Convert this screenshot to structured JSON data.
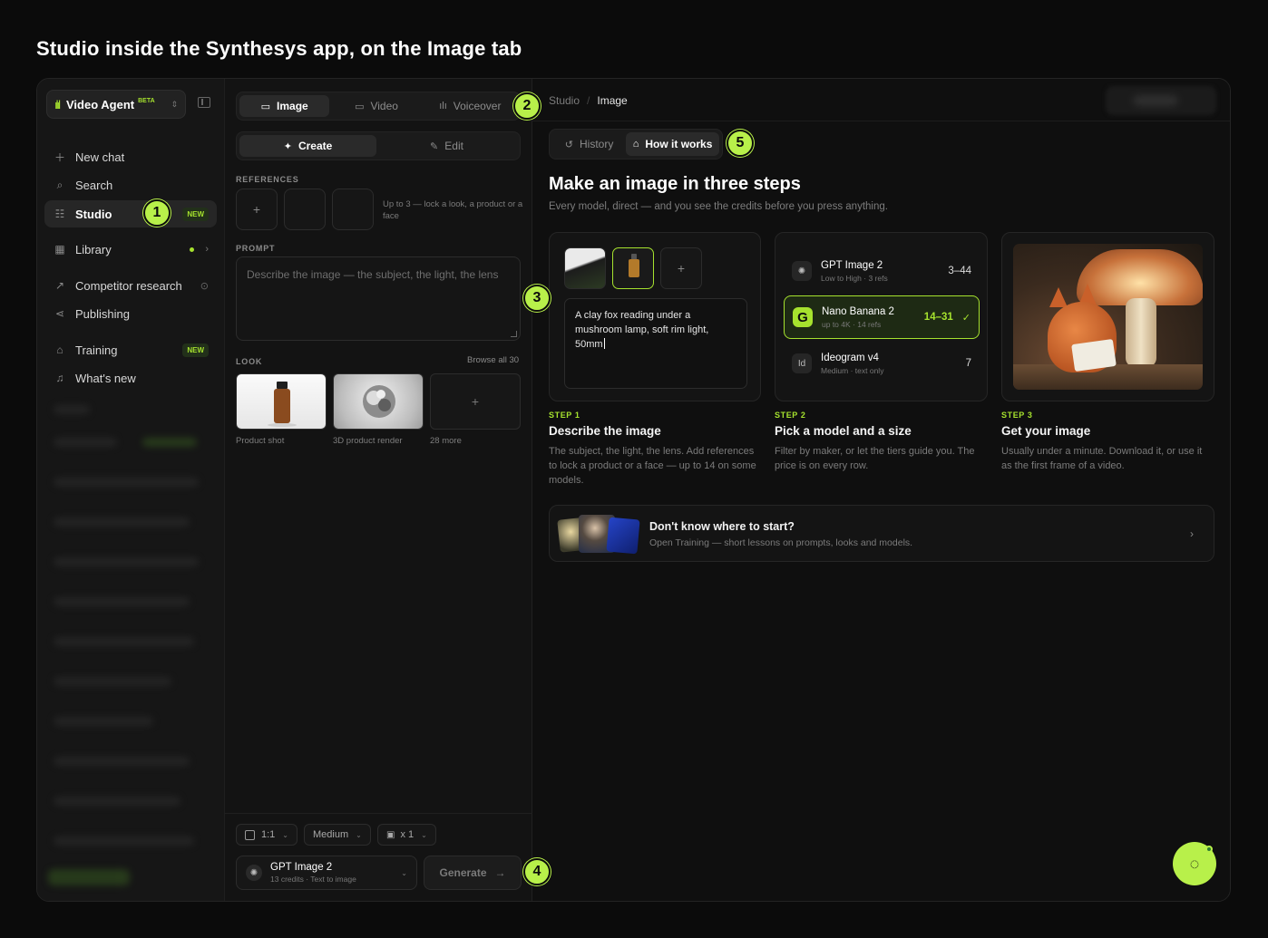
{
  "page_title": "Studio inside the Synthesys app, on the Image tab",
  "sidebar": {
    "agent_name": "Video Agent",
    "agent_badge": "BETA",
    "items": [
      {
        "label": "New chat",
        "icon": "plus-icon"
      },
      {
        "label": "Search",
        "icon": "search-icon"
      },
      {
        "label": "Studio",
        "icon": "sliders-icon",
        "badge": "NEW",
        "active": true
      },
      {
        "label": "Library",
        "icon": "grid-icon"
      },
      {
        "label": "Competitor research",
        "icon": "trend-icon"
      },
      {
        "label": "Publishing",
        "icon": "share-icon"
      },
      {
        "label": "Training",
        "icon": "graduation-cap-icon",
        "badge": "NEW"
      },
      {
        "label": "What's new",
        "icon": "bell-icon"
      }
    ]
  },
  "composer": {
    "mode_tabs": [
      "Image",
      "Video",
      "Voiceover"
    ],
    "action_tabs": [
      "Create",
      "Edit"
    ],
    "references_label": "REFERENCES",
    "references_hint": "Up to 3 — lock a look, a product or a face",
    "prompt_label": "PROMPT",
    "prompt_placeholder": "Describe the image — the subject, the light, the lens",
    "look_label": "LOOK",
    "browse_all": "Browse all 30",
    "looks": [
      "Product shot",
      "3D product render",
      "28 more"
    ],
    "aspect": "1:1",
    "quality": "Medium",
    "count": "x 1",
    "model_name": "GPT Image 2",
    "model_sub": "13 credits · Text to image",
    "generate_label": "Generate"
  },
  "main": {
    "breadcrumb": [
      "Studio",
      "Image"
    ],
    "tabs": [
      "History",
      "How it works"
    ],
    "heading": "Make an image in three steps",
    "subheading": "Every model, direct — and you see the credits before you press anything.",
    "step1": {
      "prompt_text": "A clay fox reading under a mushroom lamp, soft rim light, 50mm",
      "no": "STEP 1",
      "title": "Describe the image",
      "desc": "The subject, the light, the lens. Add references to lock a product or a face — up to 14 on some models."
    },
    "step2": {
      "models": [
        {
          "name": "GPT Image 2",
          "sub": "Low to High · 3 refs",
          "price": "3–44",
          "icon": "G"
        },
        {
          "name": "Nano Banana 2",
          "sub": "up to 4K · 14 refs",
          "price": "14–31",
          "icon": "G",
          "selected": true
        },
        {
          "name": "Ideogram v4",
          "sub": "Medium · text only",
          "price": "7",
          "icon": "Id"
        }
      ],
      "no": "STEP 2",
      "title": "Pick a model and a size",
      "desc": "Filter by maker, or let the tiers guide you. The price is on every row."
    },
    "step3": {
      "no": "STEP 3",
      "title": "Get your image",
      "desc": "Usually under a minute. Download it, or use it as the first frame of a video."
    },
    "banner": {
      "title": "Don't know where to start?",
      "sub": "Open Training — short lessons on prompts, looks and models."
    }
  },
  "callouts": [
    "1",
    "2",
    "3",
    "4",
    "5"
  ],
  "colors": {
    "accent": "#b8f04a",
    "bg": "#0b0b0b"
  }
}
